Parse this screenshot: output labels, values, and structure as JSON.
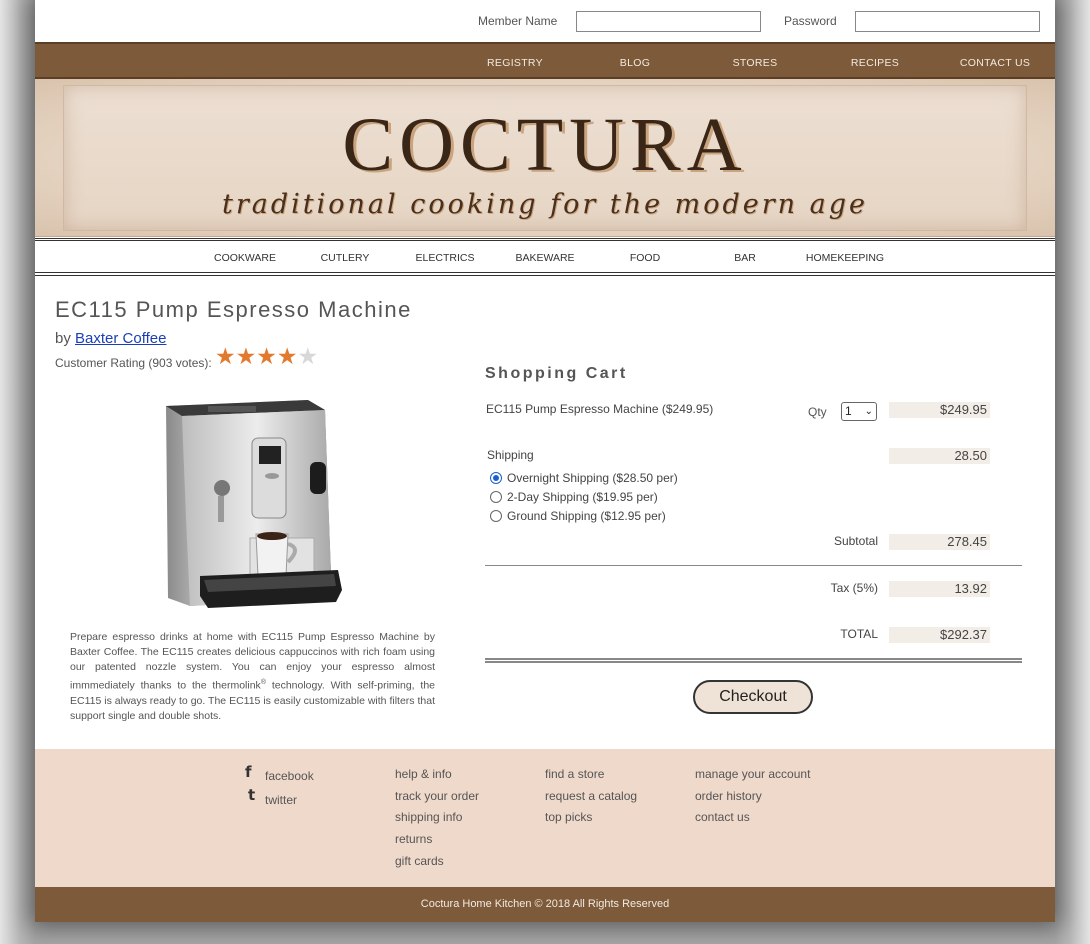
{
  "login": {
    "member_label": "Member Name",
    "password_label": "Password",
    "member_value": "",
    "password_value": ""
  },
  "top_nav": [
    "REGISTRY",
    "BLOG",
    "STORES",
    "RECIPES",
    "CONTACT US"
  ],
  "banner": {
    "brand": "COCTURA",
    "tagline": "traditional cooking for the modern age"
  },
  "category_nav": [
    "COOKWARE",
    "CUTLERY",
    "ELECTRICS",
    "BAKEWARE",
    "FOOD",
    "BAR",
    "HOMEKEEPING"
  ],
  "product": {
    "title": "EC115 Pump Espresso Machine",
    "by_prefix": "by",
    "brand_link": "Baxter Coffee",
    "rating_text": "Customer Rating (903 votes):",
    "rating_stars": 4,
    "rating_max": 5,
    "description_part1": "Prepare espresso drinks at home with EC115 Pump Espresso Machine by Baxter Coffee. The EC115 creates delicious cappuccinos with rich foam using our patented nozzle system. You can enjoy your espresso almost immmediately thanks to the thermolink",
    "description_sup": "®",
    "description_part2": " technology. With self-priming, the EC115 is always ready to go. The EC115 is easily customizable with filters that support single and double shots."
  },
  "cart": {
    "title": "Shopping Cart",
    "item_name": "EC115 Pump Espresso Machine ($249.95)",
    "qty_label": "Qty",
    "qty_value": "1",
    "item_total": "$249.95",
    "shipping_label": "Shipping",
    "shipping_total": "28.50",
    "shipping_options": [
      "Overnight Shipping ($28.50 per)",
      "2-Day Shipping ($19.95 per)",
      "Ground Shipping ($12.95 per)"
    ],
    "selected_shipping": 0,
    "subtotal_label": "Subtotal",
    "subtotal_value": "278.45",
    "tax_label": "Tax (5%)",
    "tax_value": "13.92",
    "total_label": "TOTAL",
    "total_value": "$292.37",
    "checkout_label": "Checkout"
  },
  "footer": {
    "social": {
      "facebook": "facebook",
      "twitter": "twitter",
      "facebook_icon": "f",
      "twitter_icon": "t"
    },
    "col1": [
      "help & info",
      "track your order",
      "shipping info",
      "returns",
      "gift cards"
    ],
    "col2": [
      "find a store",
      "request a catalog",
      "top picks"
    ],
    "col3": [
      "manage your account",
      "order history",
      "contact us"
    ],
    "copyright": "Coctura Home Kitchen © 2018 All Rights Reserved"
  },
  "colors": {
    "nav_brown": "#7c5a3a",
    "footer_bg": "#efd9cb",
    "star_on": "#e27a2e",
    "link_blue": "#1a3fb8"
  }
}
